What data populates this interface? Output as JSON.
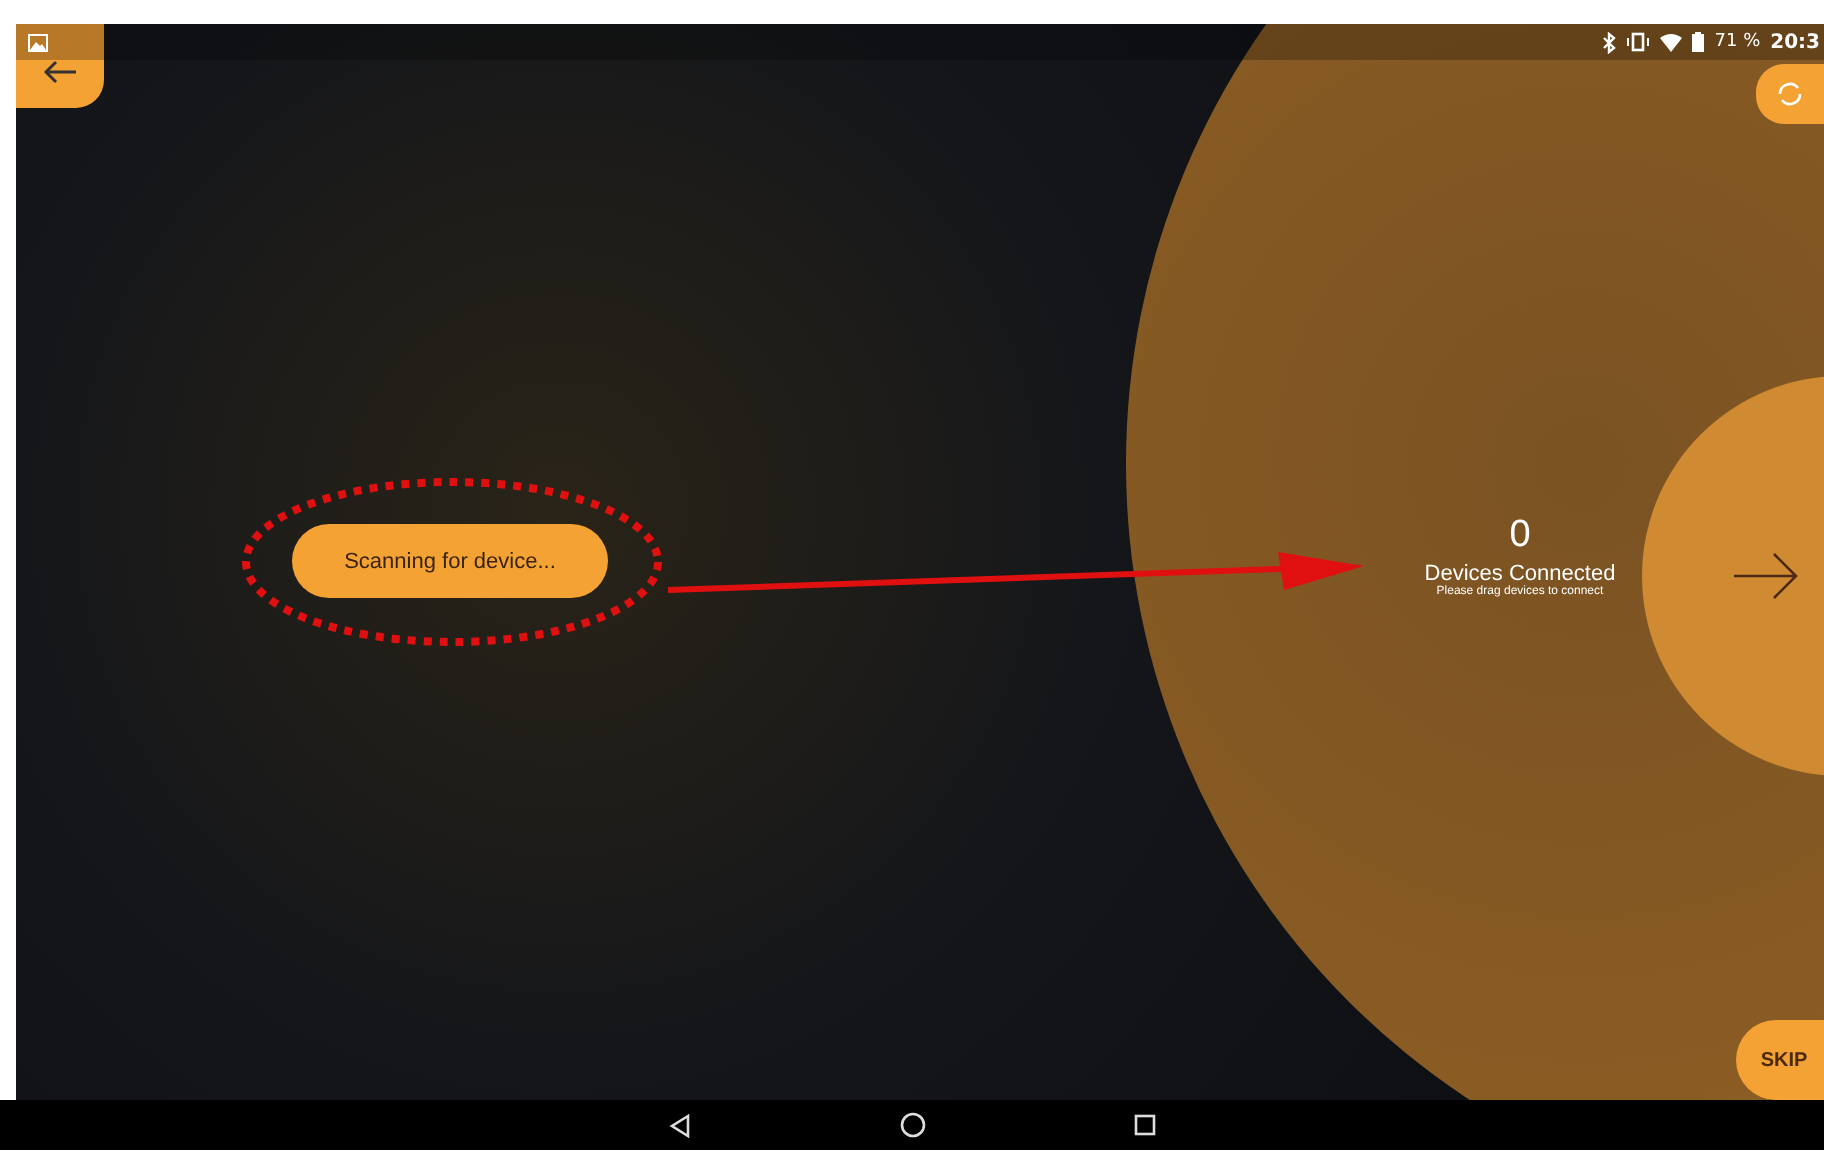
{
  "status_bar": {
    "battery": "71 %",
    "time": "20:3"
  },
  "scan_button": {
    "label": "Scanning for device..."
  },
  "devices": {
    "count": "0",
    "label": "Devices Connected",
    "hint": "Please drag devices to connect"
  },
  "skip_button": {
    "label": "SKIP"
  }
}
